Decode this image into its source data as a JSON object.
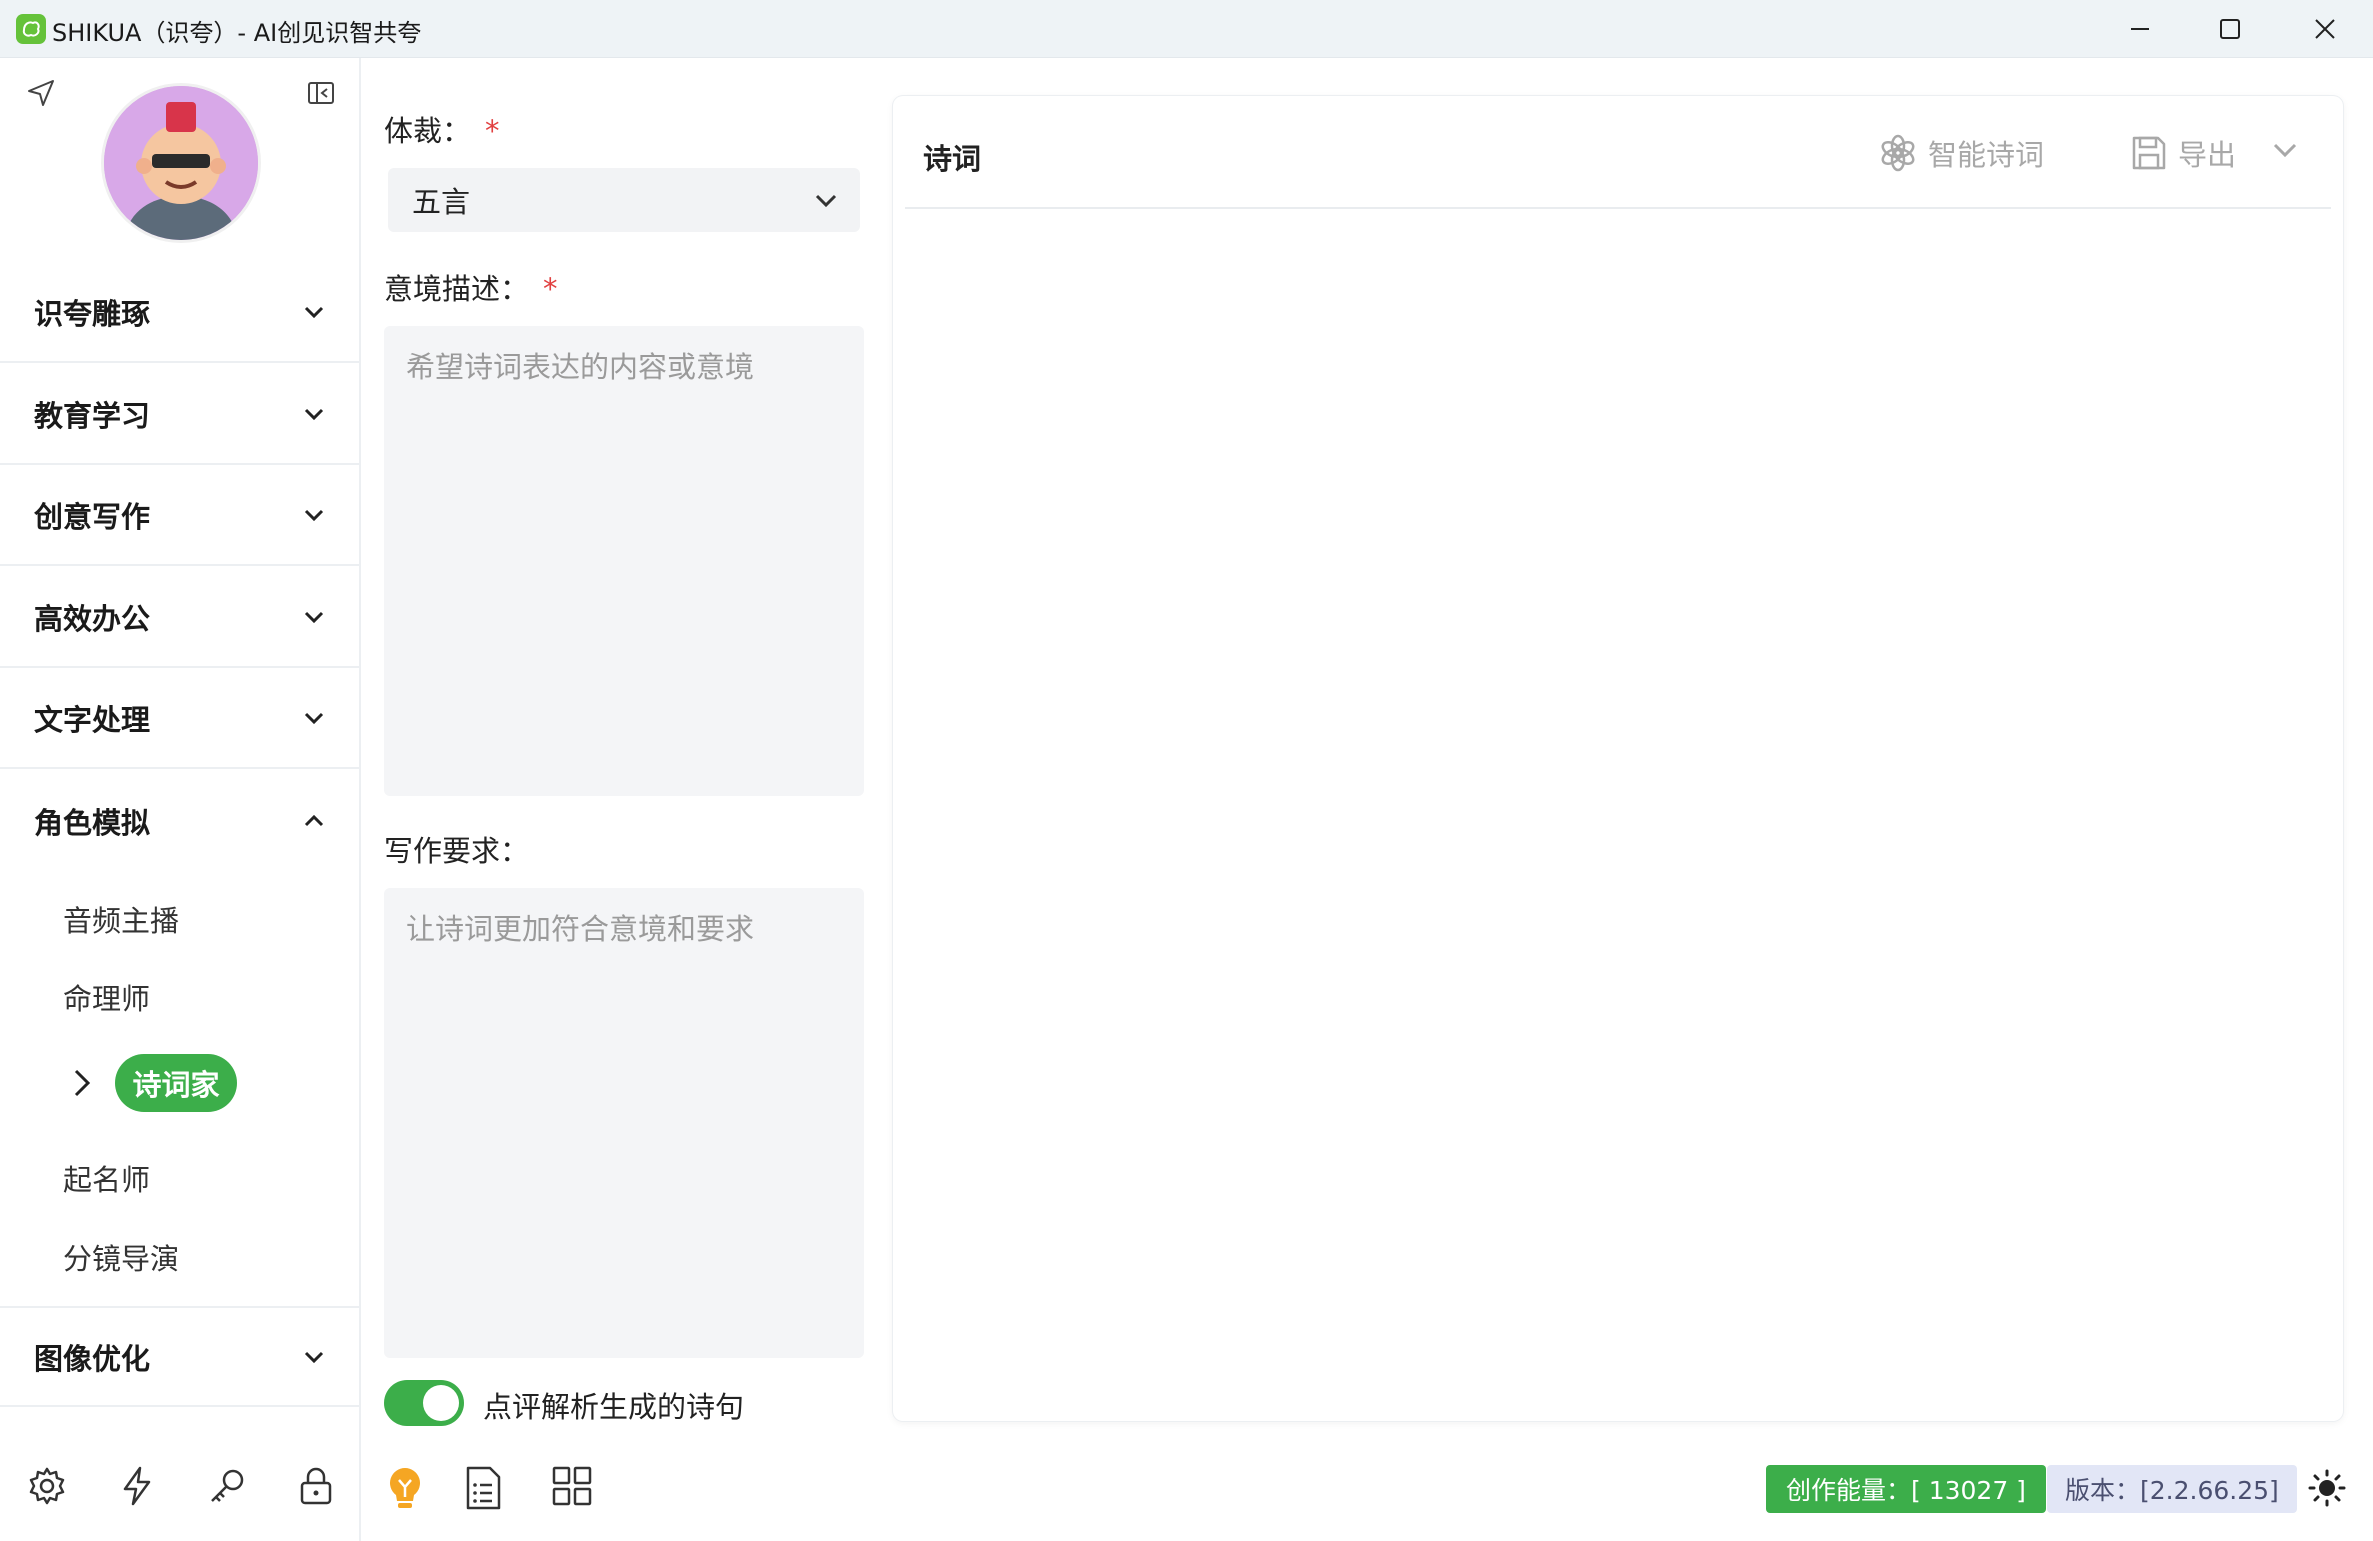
{
  "window": {
    "title": "SHIKUA（识夸）- AI创见识智共夸"
  },
  "sidebar": {
    "groups": [
      {
        "label": "识夸雕琢",
        "expanded": false
      },
      {
        "label": "教育学习",
        "expanded": false
      },
      {
        "label": "创意写作",
        "expanded": false
      },
      {
        "label": "高效办公",
        "expanded": false
      },
      {
        "label": "文字处理",
        "expanded": false
      },
      {
        "label": "角色模拟",
        "expanded": true
      },
      {
        "label": "图像优化",
        "expanded": false
      }
    ],
    "role_items": [
      {
        "label": "音频主播"
      },
      {
        "label": "命理师"
      },
      {
        "label": "诗词家",
        "active": true
      },
      {
        "label": "起名师"
      },
      {
        "label": "分镜导演"
      }
    ],
    "bottom_icons": [
      "settings-icon",
      "lightning-icon",
      "key-icon",
      "lock-icon"
    ]
  },
  "form": {
    "genre_label": "体裁：",
    "genre_required": "*",
    "genre_value": "五言",
    "mood_label": "意境描述：",
    "mood_required": "*",
    "mood_placeholder": "希望诗词表达的内容或意境",
    "req_label": "写作要求：",
    "req_placeholder": "让诗词更加符合意境和要求",
    "toggle_on": true,
    "toggle_label": "点评解析生成的诗句",
    "bottom_icons": [
      "lightbulb-icon",
      "list-document-icon",
      "grid-icon"
    ]
  },
  "card": {
    "title": "诗词",
    "generate_label": "智能诗词",
    "export_label": "导出"
  },
  "status": {
    "energy_text": "创作能量：[ 13027 ]",
    "version_text": "版本：[2.2.66.25]"
  },
  "colors": {
    "accent_green": "#3cae4a",
    "required_red": "#e14141",
    "version_bg": "#e2e6f6"
  }
}
